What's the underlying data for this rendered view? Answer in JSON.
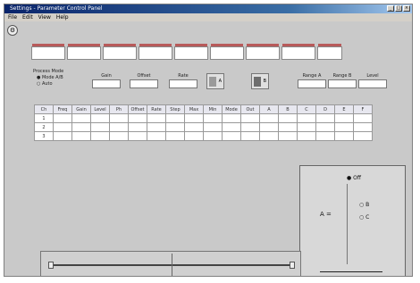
{
  "window": {
    "title": "Settings - Parameter Control Panel",
    "controls": [
      "_",
      "□",
      "×"
    ]
  },
  "menu": [
    "File",
    "Edit",
    "View",
    "Help"
  ],
  "toolbar_icon": "gear-icon",
  "header_fields": [
    "",
    "",
    "",
    "",
    "",
    "",
    "",
    "",
    ""
  ],
  "left_labels": {
    "line1": "Process Mode",
    "line2": "● Mode A/B",
    "line3": "○ Auto"
  },
  "params": [
    {
      "label": "Gain",
      "value": ""
    },
    {
      "label": "Offset",
      "value": ""
    },
    {
      "label": "Rate",
      "value": ""
    },
    {
      "label": "Range A",
      "value": ""
    },
    {
      "label": "Range B",
      "value": ""
    },
    {
      "label": "Level",
      "value": ""
    }
  ],
  "minis": [
    {
      "name": "A"
    },
    {
      "name": "B"
    }
  ],
  "grid": {
    "headers": [
      "Ch",
      "Freq",
      "Gain",
      "Level",
      "Ph",
      "Offset",
      "Rate",
      "Step",
      "Max",
      "Min",
      "Mode",
      "Out",
      "A",
      "B",
      "C",
      "D",
      "E",
      "F"
    ],
    "rows": [
      [
        "1",
        "",
        "",
        "",
        "",
        "",
        "",
        "",
        "",
        "",
        "",
        "",
        "",
        "",
        "",
        "",
        "",
        ""
      ],
      [
        "2",
        "",
        "",
        "",
        "",
        "",
        "",
        "",
        "",
        "",
        "",
        "",
        "",
        "",
        "",
        "",
        "",
        ""
      ],
      [
        "3",
        "",
        "",
        "",
        "",
        "",
        "",
        "",
        "",
        "",
        "",
        "",
        "",
        "",
        "",
        "",
        "",
        ""
      ]
    ]
  },
  "panel": {
    "top_option": "● Off",
    "left_label": "A =",
    "opt_b": "○ B",
    "opt_c": "○ C"
  }
}
